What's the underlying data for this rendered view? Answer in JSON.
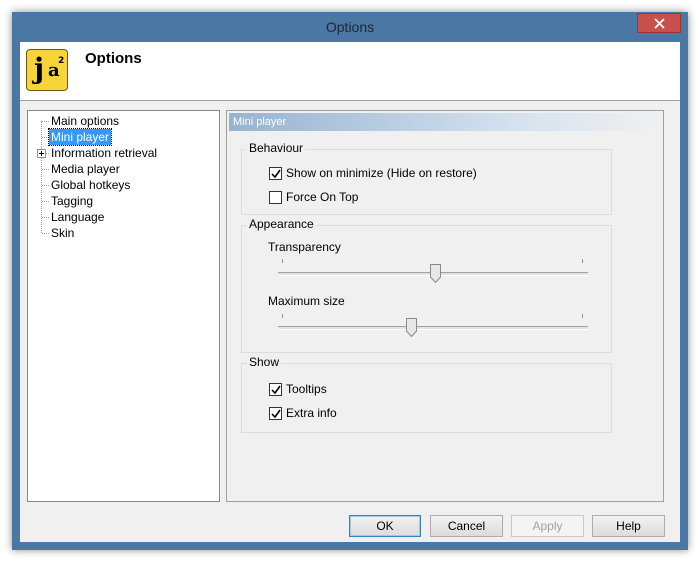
{
  "window": {
    "title": "Options"
  },
  "header": {
    "title": "Options",
    "logo_letters": {
      "j": "j",
      "a": "a",
      "sup": "2"
    }
  },
  "tree": {
    "items": [
      {
        "label": "Main options",
        "selected": false
      },
      {
        "label": "Mini player",
        "selected": true
      },
      {
        "label": "Information retrieval",
        "selected": false,
        "expandable": true
      },
      {
        "label": "Media player",
        "selected": false
      },
      {
        "label": "Global hotkeys",
        "selected": false
      },
      {
        "label": "Tagging",
        "selected": false
      },
      {
        "label": "Language",
        "selected": false
      },
      {
        "label": "Skin",
        "selected": false
      }
    ]
  },
  "panel": {
    "header": "Mini player",
    "behaviour": {
      "label": "Behaviour",
      "show_on_minimize": {
        "label": "Show on minimize (Hide on restore)",
        "checked": true
      },
      "force_on_top": {
        "label": "Force On Top",
        "checked": false
      }
    },
    "appearance": {
      "label": "Appearance",
      "transparency": {
        "label": "Transparency",
        "value": 0.5
      },
      "maximum_size": {
        "label": "Maximum size",
        "value": 0.43
      }
    },
    "show": {
      "label": "Show",
      "tooltips": {
        "label": "Tooltips",
        "checked": true
      },
      "extra_info": {
        "label": "Extra info",
        "checked": true
      }
    }
  },
  "buttons": {
    "ok": "OK",
    "cancel": "Cancel",
    "apply": "Apply",
    "help": "Help"
  },
  "colors": {
    "selection": "#3399ff",
    "frame": "#4a77a3",
    "close": "#c7504d",
    "logo": "#f7d43a"
  }
}
